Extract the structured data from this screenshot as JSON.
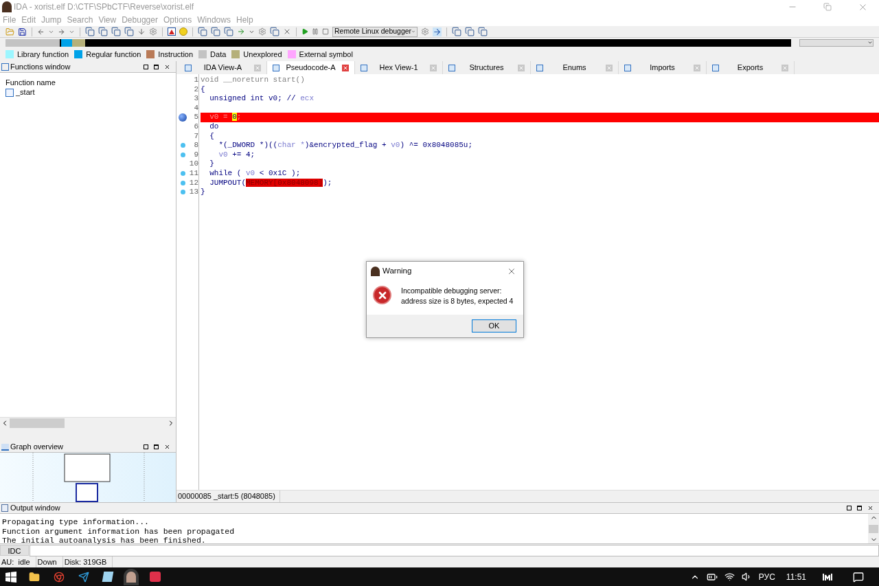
{
  "window": {
    "title": "IDA - xorist.elf D:\\CTF\\SPbCTF\\Reverse\\xorist.elf"
  },
  "menu": [
    "File",
    "Edit",
    "Jump",
    "Search",
    "View",
    "Debugger",
    "Options",
    "Windows",
    "Help"
  ],
  "toolbar": {
    "debugger_select": "Remote Linux debugger"
  },
  "legend": [
    {
      "label": "Library function",
      "color": "#9cf6ff"
    },
    {
      "label": "Regular function",
      "color": "#00a2e8"
    },
    {
      "label": "Instruction",
      "color": "#b97a57"
    },
    {
      "label": "Data",
      "color": "#c3c3c3"
    },
    {
      "label": "Unexplored",
      "color": "#b5b07a"
    },
    {
      "label": "External symbol",
      "color": "#ffa6ff"
    }
  ],
  "functions_window": {
    "title": "Functions window",
    "column": "Function name",
    "items": [
      {
        "name": "_start",
        "selected": false
      }
    ]
  },
  "graph_overview": {
    "title": "Graph overview"
  },
  "tabs": [
    {
      "label": "IDA View-A",
      "selected": false
    },
    {
      "label": "Pseudocode-A",
      "selected": true
    },
    {
      "label": "Hex View-1",
      "selected": false
    },
    {
      "label": "Structures",
      "selected": false
    },
    {
      "label": "Enums",
      "selected": false
    },
    {
      "label": "Imports",
      "selected": false
    },
    {
      "label": "Exports",
      "selected": false
    }
  ],
  "code": [
    {
      "number": "1",
      "kind": "plain",
      "highlighted": false,
      "tokens": [
        {
          "text": "void __noreturn start()",
          "kind": "decl"
        }
      ]
    },
    {
      "number": "2",
      "kind": "plain",
      "highlighted": false,
      "tokens": [
        {
          "text": "{",
          "kind": "plain"
        }
      ]
    },
    {
      "number": "3",
      "kind": "plain",
      "highlighted": false,
      "tokens": [
        {
          "text": "  unsigned int v0; // ",
          "kind": "plain"
        },
        {
          "text": "ecx",
          "kind": "local"
        }
      ]
    },
    {
      "number": "4",
      "kind": "plain",
      "highlighted": false
    },
    {
      "number": "5",
      "kind": "breakpoint",
      "highlighted": true,
      "tokens": [
        {
          "text": "  v0 = ",
          "kind": "plain"
        },
        {
          "text": "0",
          "kind": "cursor"
        },
        {
          "text": ";",
          "kind": "plain"
        }
      ]
    },
    {
      "number": "6",
      "kind": "plain",
      "highlighted": false,
      "tokens": [
        {
          "text": "  do",
          "kind": "plain"
        }
      ]
    },
    {
      "number": "7",
      "kind": "plain",
      "highlighted": false,
      "tokens": [
        {
          "text": "  {",
          "kind": "plain"
        }
      ]
    },
    {
      "number": "8",
      "kind": "dot",
      "highlighted": false,
      "tokens": [
        {
          "text": "    *(_DWORD *)((",
          "kind": "plain"
        },
        {
          "text": "char *",
          "kind": "local"
        },
        {
          "text": ")&encrypted_flag + ",
          "kind": "plain"
        },
        {
          "text": "v0",
          "kind": "local"
        },
        {
          "text": ") ^= 0x8048085u;",
          "kind": "plain"
        }
      ]
    },
    {
      "number": "9",
      "kind": "dot",
      "highlighted": false,
      "tokens": [
        {
          "text": "    v0",
          "kind": "local"
        },
        {
          "text": " += 4;",
          "kind": "plain"
        }
      ]
    },
    {
      "number": "10",
      "kind": "plain",
      "highlighted": false,
      "tokens": [
        {
          "text": "  }",
          "kind": "plain"
        }
      ]
    },
    {
      "number": "11",
      "kind": "dot",
      "highlighted": false,
      "tokens": [
        {
          "text": "  while ( ",
          "kind": "plain"
        },
        {
          "text": "v0",
          "kind": "local"
        },
        {
          "text": " < 0x1C );",
          "kind": "plain"
        }
      ]
    },
    {
      "number": "12",
      "kind": "dot",
      "highlighted": false,
      "tokens": [
        {
          "text": "  JUMPOUT(",
          "kind": "plain"
        },
        {
          "text": "MEMORY[0x8048098]",
          "kind": "error"
        },
        {
          "text": ");",
          "kind": "plain"
        }
      ]
    },
    {
      "number": "13",
      "kind": "dot",
      "highlighted": false,
      "tokens": [
        {
          "text": "}",
          "kind": "plain"
        }
      ]
    }
  ],
  "code_status": "00000085 _start:5 (8048085)",
  "output_window": {
    "title": "Output window",
    "lines": [
      "Propagating type information...",
      "Function argument information has been propagated",
      "The initial autoanalysis has been finished."
    ]
  },
  "command": {
    "button": "IDC"
  },
  "status_bar": [
    "AU:  idle",
    "Down",
    "Disk: 319GB"
  ],
  "dialog": {
    "title": "Warning",
    "message": "Incompatible debugging server:\naddress size is 8 bytes, expected 4",
    "button": "OK"
  },
  "taskbar": {
    "language": "РУС",
    "time": "11:51"
  }
}
